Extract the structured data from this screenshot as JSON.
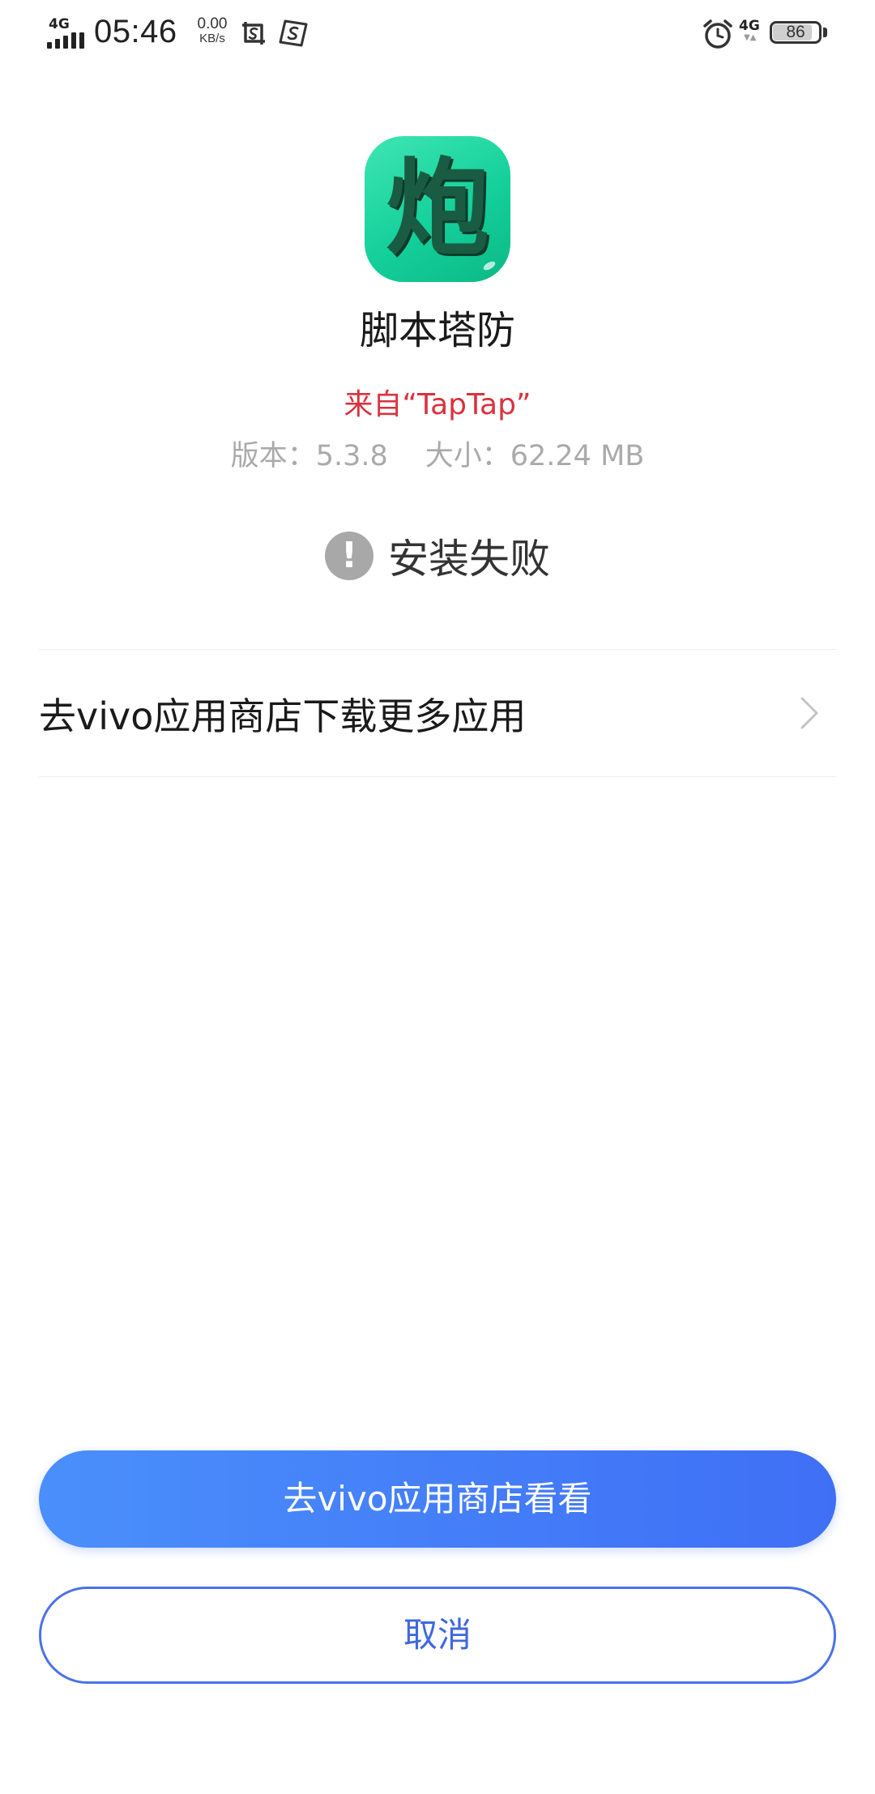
{
  "status_bar": {
    "network_left": "4G",
    "time": "05:46",
    "speed_value": "0.00",
    "speed_unit": "KB/s",
    "network_right": "4G",
    "battery": "86",
    "battery_level": 0.86,
    "icons": [
      "signal-icon",
      "screenshot-app-icon",
      "s-app-icon",
      "alarm-icon",
      "battery-icon"
    ]
  },
  "app": {
    "icon_glyph": "炮",
    "name": "脚本塔防",
    "source": "来自“TapTap”",
    "version": "版本：5.3.8",
    "size": "大小：62.24 MB",
    "icon_color": "#1fd39f"
  },
  "install": {
    "status_icon": "!",
    "status": "安装失败"
  },
  "store_link": {
    "label": "去vivo应用商店下载更多应用"
  },
  "actions": {
    "primary": "去vivo应用商店看看",
    "secondary": "取消",
    "accent_color": "#4277f6"
  }
}
